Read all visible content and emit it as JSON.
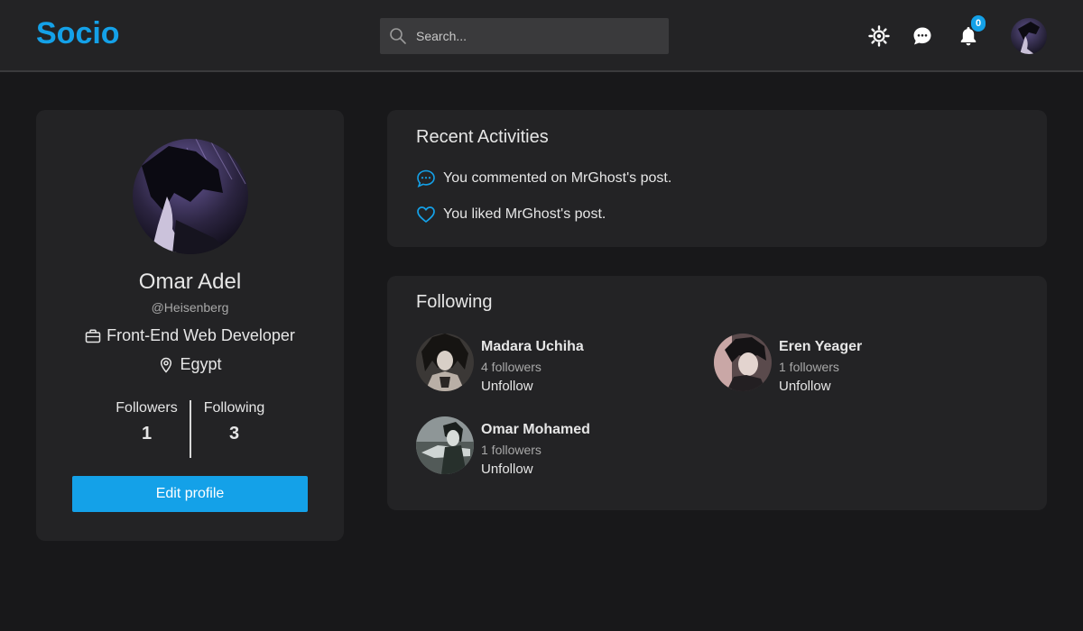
{
  "header": {
    "logo": "Socio",
    "search_placeholder": "Search...",
    "notification_count": "0"
  },
  "profile": {
    "name": "Omar Adel",
    "handle": "@Heisenberg",
    "job": "Front-End Web Developer",
    "location": "Egypt",
    "followers_label": "Followers",
    "followers_count": "1",
    "following_label": "Following",
    "following_count": "3",
    "edit_label": "Edit profile"
  },
  "activities": {
    "title": "Recent Activities",
    "items": [
      {
        "text": "You commented on MrGhost's post.",
        "icon": "comment-icon"
      },
      {
        "text": "You liked MrGhost's post.",
        "icon": "heart-icon"
      }
    ]
  },
  "following": {
    "title": "Following",
    "users": [
      {
        "name": "Madara Uchiha",
        "followers": "4 followers",
        "action": "Unfollow"
      },
      {
        "name": "Eren Yeager",
        "followers": "1 followers",
        "action": "Unfollow"
      },
      {
        "name": "Omar Mohamed",
        "followers": "1 followers",
        "action": "Unfollow"
      }
    ]
  },
  "colors": {
    "accent": "#14a1e8",
    "background": "#18181a",
    "card": "#232325"
  }
}
